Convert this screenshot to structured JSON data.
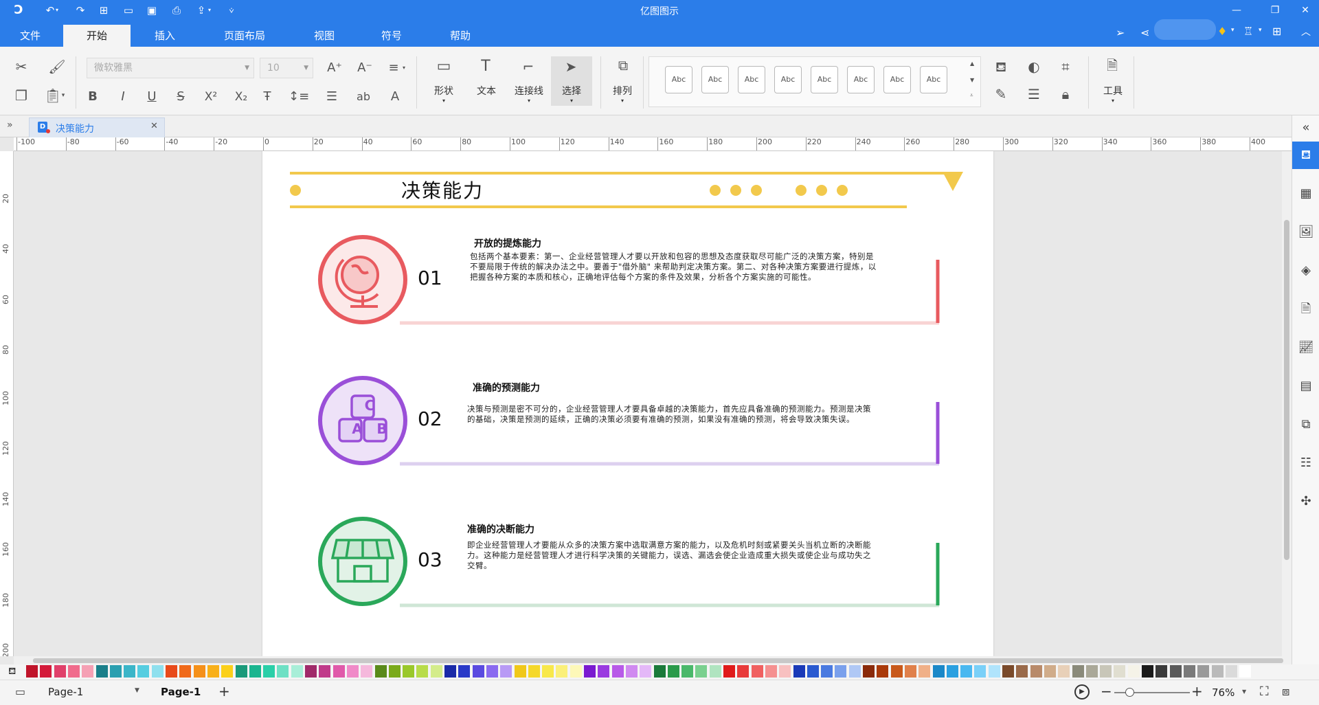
{
  "app": {
    "title": "亿图图示",
    "doc_tab_title": "决策能力"
  },
  "menu": {
    "tabs": [
      "文件",
      "开始",
      "插入",
      "页面布局",
      "视图",
      "符号",
      "帮助"
    ],
    "active": "开始"
  },
  "ribbon": {
    "font_name": "微软雅黑",
    "font_size": "10",
    "tools": {
      "shape": "形状",
      "text": "文本",
      "connector": "连接线",
      "select": "选择",
      "arrange": "排列",
      "tools": "工具"
    },
    "style_preset_label": "Abc"
  },
  "ruler": {
    "h_ticks": [
      "-100",
      "-80",
      "-60",
      "-40",
      "-20",
      "0",
      "20",
      "40",
      "60",
      "80",
      "100",
      "120",
      "140",
      "160",
      "180",
      "200",
      "220",
      "240",
      "260",
      "280",
      "300",
      "320",
      "340",
      "360",
      "380",
      "400"
    ],
    "v_ticks": [
      "20",
      "40",
      "60",
      "80",
      "100",
      "120",
      "140",
      "160",
      "180",
      "200"
    ]
  },
  "document": {
    "title": "决策能力",
    "sections": [
      {
        "number": "01",
        "heading": "开放的提炼能力",
        "body_lines": [
          "包括两个基本要素：第一、企业经营管理人才要以开放和包容的思想及态度获取尽可能广泛的决策方案，特别是",
          "不要局限于传统的解决办法之中。要善于\"借外脑\" 来帮助判定决策方案。第二、对各种决策方案要进行提炼，以",
          "把握各种方案的本质和核心，正确地评估每个方案的条件及效果，分析各个方案实施的可能性。"
        ],
        "color": "#e85a5f",
        "light": "#f8d3d3",
        "icon": "globe-icon"
      },
      {
        "number": "02",
        "heading": "准确的预测能力",
        "body_lines": [
          "决策与预测是密不可分的，企业经营管理人才要具备卓越的决策能力，首先应具备准确的预测能力。预测是决策",
          "的基础，决策是预测的延续，正确的决策必须要有准确的预测，如果没有准确的预测，将会导致决策失误。"
        ],
        "color": "#9a4fd8",
        "light": "#ddd0ef",
        "icon": "abc-blocks-icon",
        "block_letters": [
          "C",
          "A",
          "B"
        ]
      },
      {
        "number": "03",
        "heading": "准确的决断能力",
        "body_lines": [
          "即企业经营管理人才要能从众多的决策方案中选取满意方案的能力，以及危机时刻或紧要关头当机立断的决断能",
          "力。这种能力是经营管理人才进行科学决策的关键能力，误选、漏选会使企业造成重大损失或使企业与成功失之",
          "交臂。"
        ],
        "color": "#2aa85a",
        "light": "#cfe6d6",
        "icon": "storefront-icon"
      }
    ],
    "accent_yellow": "#f2c94c"
  },
  "palette_colors": [
    "#c0142a",
    "#d41a3a",
    "#e0406a",
    "#f06b8c",
    "#f5a0b4",
    "#1a7f8a",
    "#2a9fb0",
    "#3bb5c8",
    "#55cde0",
    "#8fe0ee",
    "#e84a1a",
    "#f06a1a",
    "#f5901a",
    "#f8b01a",
    "#fbd01a",
    "#1a9a7a",
    "#1ab58f",
    "#2acfa8",
    "#6ee0c4",
    "#a8eed8",
    "#a02a6a",
    "#c03a8a",
    "#e05aaa",
    "#f08ac8",
    "#f5b8dc",
    "#5a8a1a",
    "#7aaa1a",
    "#9ac82a",
    "#b8dc4a",
    "#d4ec8a",
    "#1a2aa8",
    "#2a3ac8",
    "#5a4ae0",
    "#8a6af0",
    "#b89af5",
    "#f0c81a",
    "#f5d82a",
    "#f8e84a",
    "#fbf07a",
    "#fdf8b8",
    "#7a1ad0",
    "#9a3ae0",
    "#b85ae8",
    "#d08af0",
    "#e4b8f8",
    "#1a7a3a",
    "#2a9a4a",
    "#4ab86a",
    "#7ad08f",
    "#b0e4c0",
    "#e01a1a",
    "#e83a3a",
    "#f06060",
    "#f59090",
    "#f8c0c0",
    "#1a3ab8",
    "#2a5ad0",
    "#4a7ae0",
    "#7aa0ec",
    "#b0c8f5",
    "#8a2a0a",
    "#aa3a0a",
    "#c8581a",
    "#e0804a",
    "#f0b088",
    "#1a88c8",
    "#2aa0e0",
    "#4ab8f0",
    "#7ad0f8",
    "#b0e4fc",
    "#7a4a2a",
    "#9a6a4a",
    "#b88a6a",
    "#d0ac8a",
    "#e8d0b8",
    "#8a8a7a",
    "#aaa898",
    "#c8c6b8",
    "#e0ded0",
    "#f5f3e8",
    "#1a1a1a",
    "#3a3a3a",
    "#5a5a5a",
    "#7a7a7a",
    "#9a9a9a",
    "#bababa",
    "#dadada",
    "#ffffff"
  ],
  "status": {
    "page_selector": "Page-1",
    "current_page": "Page-1",
    "add_page": "+",
    "zoom": "76%"
  }
}
